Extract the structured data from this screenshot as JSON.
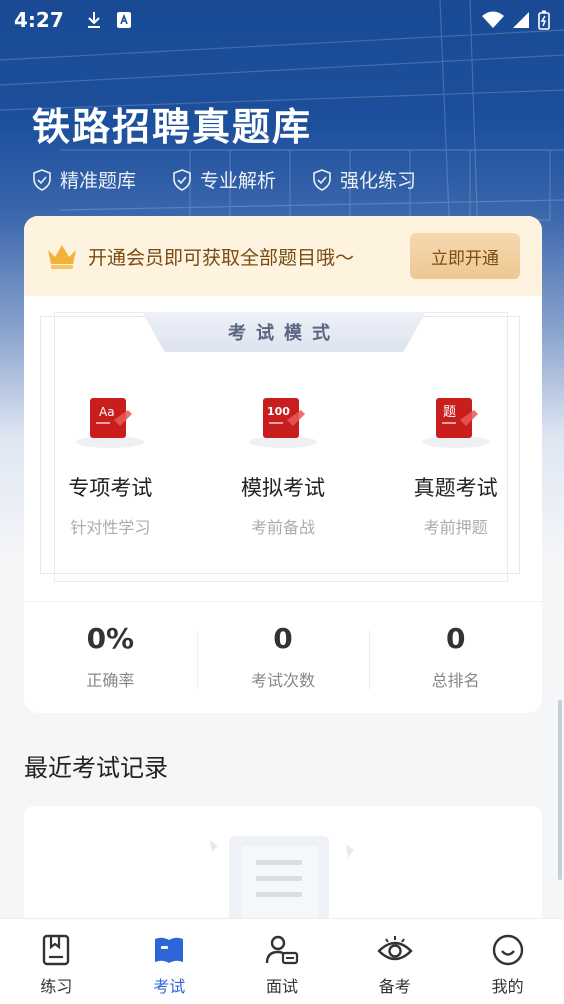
{
  "status_bar": {
    "time": "4:27"
  },
  "header": {
    "title": "铁路招聘真题库",
    "features": [
      "精准题库",
      "专业解析",
      "强化练习"
    ]
  },
  "vip_banner": {
    "text": "开通会员即可获取全部题目哦～",
    "button": "立即开通"
  },
  "exam_mode": {
    "title": "考试模式",
    "modes": [
      {
        "label": "专项考试",
        "sub": "针对性学习",
        "icon_text": "Aa",
        "icon": "special-exam-icon"
      },
      {
        "label": "模拟考试",
        "sub": "考前备战",
        "icon_text": "100",
        "icon": "mock-exam-icon"
      },
      {
        "label": "真题考试",
        "sub": "考前押题",
        "icon_text": "题",
        "icon": "real-exam-icon"
      }
    ]
  },
  "stats": [
    {
      "value": "0%",
      "label": "正确率"
    },
    {
      "value": "0",
      "label": "考试次数"
    },
    {
      "value": "0",
      "label": "总排名"
    }
  ],
  "recent": {
    "title": "最近考试记录"
  },
  "tabbar": {
    "active": "考试",
    "tabs": [
      {
        "label": "练习",
        "icon": "practice-icon"
      },
      {
        "label": "考试",
        "icon": "exam-icon"
      },
      {
        "label": "面试",
        "icon": "interview-icon"
      },
      {
        "label": "备考",
        "icon": "prepare-icon"
      },
      {
        "label": "我的",
        "icon": "profile-icon"
      }
    ]
  },
  "colors": {
    "header_blue": "#1a4a94",
    "accent_blue": "#2d66d6",
    "vip_bg": "#fdf3df",
    "icon_red": "#c81e1e"
  }
}
